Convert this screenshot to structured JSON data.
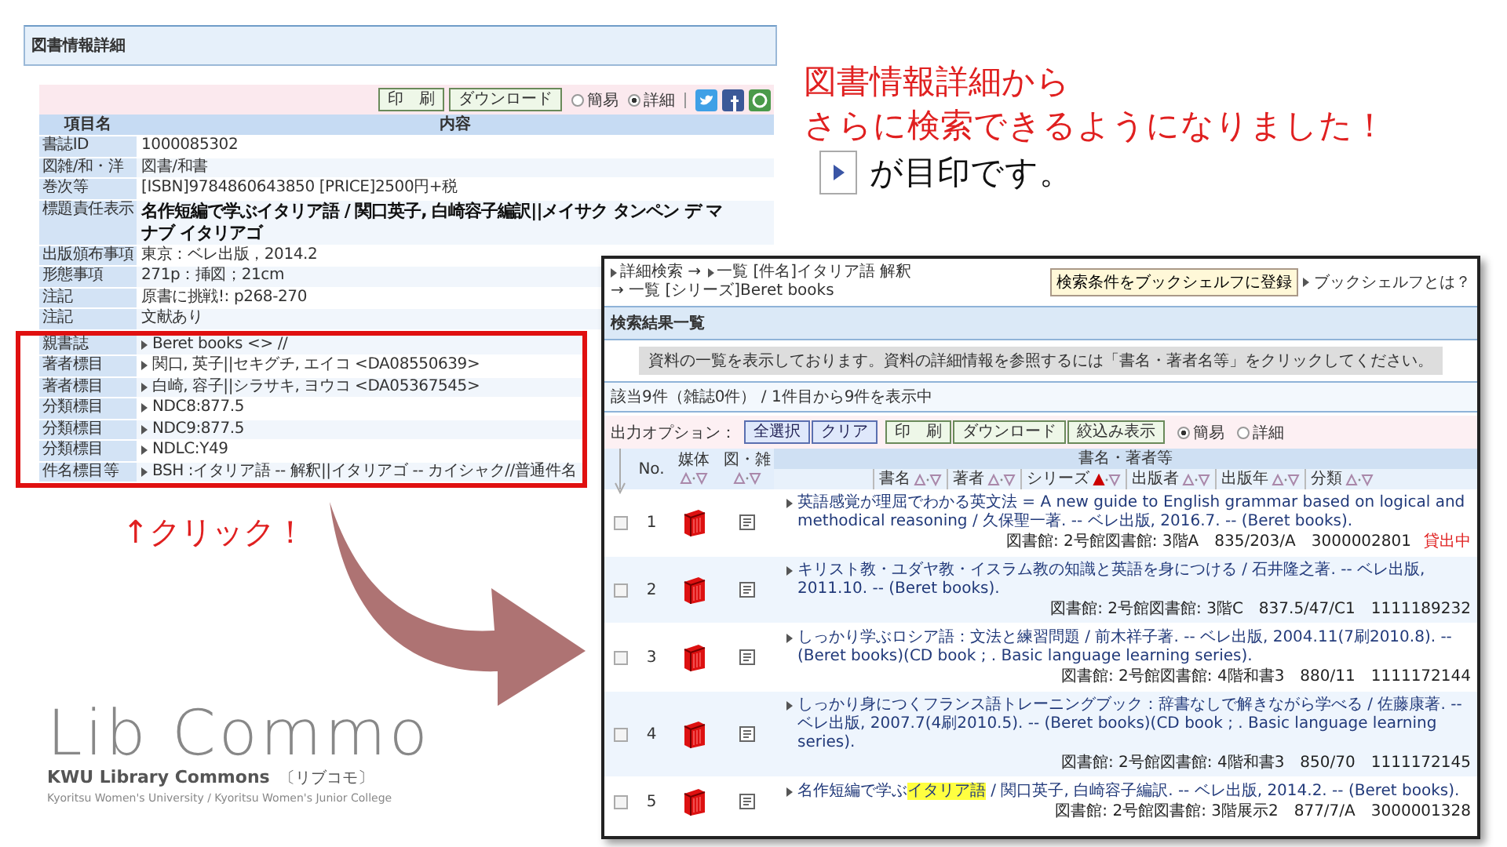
{
  "callout": {
    "lines": [
      "図書情報詳細から",
      "さらに検索できるようになりました！"
    ],
    "marker_note": "が目印です。"
  },
  "click_label": "↑クリック！",
  "logo": {
    "wordmark": "Lib Commo",
    "name": "KWU Library Commons",
    "kana": "〔リブコモ〕",
    "org": "Kyoritsu Women's University / Kyoritsu Women's Junior College"
  },
  "detail_panel": {
    "title": "図書情報詳細",
    "buttons": [
      "印　刷",
      "ダウンロード"
    ],
    "view_options": [
      {
        "label": "簡易",
        "selected": false
      },
      {
        "label": "詳細",
        "selected": true
      }
    ],
    "columns": [
      "項目名",
      "内容"
    ],
    "rows": [
      {
        "label": "書誌ID",
        "value": "1000085302",
        "kind": "plain"
      },
      {
        "label": "図雑/和・洋",
        "value": "図書/和書",
        "kind": "plain"
      },
      {
        "label": "巻次等",
        "value": "[ISBN]9784860643850 [PRICE]2500円+税",
        "kind": "plain"
      },
      {
        "label": "標題責任表示",
        "value": "名作短編で学ぶイタリア語 / 関口英子, 白崎容子編訳||メイサク タンペン デ マナブ イタリアゴ",
        "kind": "title"
      },
      {
        "label": "出版頒布事項",
        "value": "東京：ベレ出版，2014.2",
        "kind": "plain"
      },
      {
        "label": "形態事項",
        "value": "271p：挿図；21cm",
        "kind": "plain"
      },
      {
        "label": "注記",
        "value": "原書に挑戦!: p268-270",
        "kind": "plain"
      },
      {
        "label": "注記",
        "value": "文献あり",
        "kind": "plain"
      }
    ],
    "framed_rows": [
      {
        "label": "親書誌",
        "value": "Beret books <> //",
        "kind": "link"
      },
      {
        "label": "著者標目",
        "value": "関口, 英子||セキグチ, エイコ <DA08550639>",
        "kind": "link"
      },
      {
        "label": "著者標目",
        "value": "白崎, 容子||シラサキ, ヨウコ <DA05367545>",
        "kind": "link"
      },
      {
        "label": "分類標目",
        "value": "NDC8:877.5",
        "kind": "link"
      },
      {
        "label": "分類標目",
        "value": "NDC9:877.5",
        "kind": "link"
      },
      {
        "label": "分類標目",
        "value": "NDLC:Y49",
        "kind": "link"
      },
      {
        "label": "件名標目等",
        "value": "BSH :イタリア語 -- 解釈||イタリアゴ -- カイシャク//普通件名",
        "kind": "link"
      }
    ]
  },
  "results_panel": {
    "breadcrumb": [
      {
        "text": "詳細検索 →",
        "marker": true
      },
      {
        "text": "一覧 [件名]イタリア語 解釈",
        "marker": true
      },
      {
        "text": "→ 一覧 [シリーズ]Beret books",
        "marker": false
      }
    ],
    "register_button": "検索条件をブックシェルフに登録",
    "help_link": "ブックシェルフとは？",
    "title": "検索結果一覧",
    "notice": "資料の一覧を表示しております。資料の詳細情報を参照するには「書名・著者名等」をクリックしてください。",
    "count": "該当9件（雑誌0件） / 1件目から9件を表示中",
    "options_label": "出力オプション：",
    "select_buttons": [
      "全選択",
      "クリア"
    ],
    "action_buttons": [
      "印　刷",
      "ダウンロード",
      "絞込み表示"
    ],
    "view_options": [
      {
        "label": "簡易",
        "selected": true
      },
      {
        "label": "詳細",
        "selected": false
      }
    ],
    "columns": [
      {
        "label": "No.",
        "sortable": false
      },
      {
        "label": "媒体",
        "sortable": true
      },
      {
        "label": "図・雑",
        "sortable": true
      },
      {
        "label": "書名・著者等",
        "sortable": false
      }
    ],
    "sort_fields": [
      {
        "label": "書名",
        "active": false
      },
      {
        "label": "著者",
        "active": false
      },
      {
        "label": "シリーズ",
        "active": true
      },
      {
        "label": "出版者",
        "active": false
      },
      {
        "label": "出版年",
        "active": false
      },
      {
        "label": "分類",
        "active": false
      }
    ],
    "rows": [
      {
        "no": "1",
        "checked": false,
        "title": [
          {
            "text": "英語感覚が理屈でわかる英文法 = A new guide to English grammar based on logical and methodical reasoning / 久保聖一著. -- ベレ出版, 2016.7. -- (Beret books).",
            "highlighted": false
          }
        ],
        "holding": "図書館: 2号館図書館: 3階A　835/203/A　3000002801",
        "status": "貸出中"
      },
      {
        "no": "2",
        "checked": false,
        "title": [
          {
            "text": "キリスト教・ユダヤ教・イスラム教の知識と英語を身につける / 石井隆之著. -- ベレ出版, 2011.10. -- (Beret books).",
            "highlighted": false
          }
        ],
        "holding": "図書館: 2号館図書館: 3階C　837.5/47/C1　1111189232"
      },
      {
        "no": "3",
        "checked": false,
        "title": [
          {
            "text": "しっかり学ぶロシア語：文法と練習問題 / 前木祥子著. -- ベレ出版, 2004.11(7刷2010.8). -- (Beret books)(CD book ; . Basic language learning series).",
            "highlighted": false
          }
        ],
        "holding": "図書館: 2号館図書館: 4階和書3　880/11　1111172144"
      },
      {
        "no": "4",
        "checked": false,
        "title": [
          {
            "text": "しっかり身につくフランス語トレーニングブック：辞書なしで解きながら学べる / 佐藤康著. -- ベレ出版, 2007.7(4刷2010.5). -- (Beret books)(CD book ; . Basic language learning series).",
            "highlighted": false
          }
        ],
        "holding": "図書館: 2号館図書館: 4階和書3　850/70　1111172145"
      },
      {
        "no": "5",
        "checked": false,
        "title": [
          {
            "text": "名作短編で学ぶ",
            "highlighted": false
          },
          {
            "text": "イタリア語",
            "highlighted": true
          },
          {
            "text": " / 関口英子, 白崎容子編訳. -- ベレ出版, 2014.2. -- (Beret books).",
            "highlighted": false
          }
        ],
        "holding": "図書館: 2号館図書館: 3階展示2　877/7/A　3000001328"
      }
    ]
  }
}
